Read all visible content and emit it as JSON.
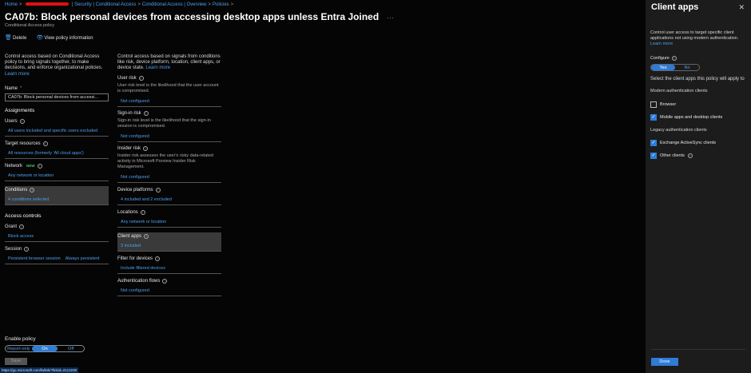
{
  "breadcrumb": {
    "home": "Home",
    "items": [
      "Security | Conditional Access",
      "Conditional Access | Overview",
      "Policies"
    ]
  },
  "page": {
    "title": "CA07b: Block personal devices from accessing desktop apps unless Entra Joined",
    "more": "···",
    "subtitle": "Conditional Access policy"
  },
  "toolbar": {
    "delete_label": "Delete",
    "view_info_label": "View policy information"
  },
  "left": {
    "intro": "Control access based on Conditional Access policy to bring signals together, to make decisions, and enforce organizational policies.",
    "learn_more": "Learn more",
    "name_label": "Name",
    "name_required": "*",
    "name_value": "CA07b: Block personal devices from accessi...",
    "assignments": "Assignments",
    "users_label": "Users",
    "users_value": "All users included and specific users excluded",
    "target_label": "Target resources",
    "target_value": "All resources (formerly 'All cloud apps')",
    "network_label": "Network",
    "network_badge": "NEW",
    "network_value": "Any network or location",
    "conditions_label": "Conditions",
    "conditions_value": "4 conditions selected",
    "access_controls": "Access controls",
    "grant_label": "Grant",
    "grant_value": "Block access",
    "session_label": "Session",
    "session_value1": "Persistent browser session",
    "session_value2": "Always persistent"
  },
  "right": {
    "intro": "Control access based on signals from conditions like risk, device platform, location, client apps, or device state.",
    "learn_more": "Learn more",
    "user_risk_label": "User risk",
    "user_risk_desc": "User risk level is the likelihood that the user account is compromised.",
    "user_risk_value": "Not configured",
    "signin_risk_label": "Sign-in risk",
    "signin_risk_desc": "Sign-in risk level is the likelihood that the sign-in session is compromised.",
    "signin_risk_value": "Not configured",
    "insider_risk_label": "Insider risk",
    "insider_risk_desc": "Insider risk assesses the user's risky data-related activity in Microsoft Purview Insider Risk Management.",
    "insider_risk_value": "Not configured",
    "device_platforms_label": "Device platforms",
    "device_platforms_value": "4 included and 2 excluded",
    "locations_label": "Locations",
    "locations_value": "Any network or location",
    "client_apps_label": "Client apps",
    "client_apps_value": "3 included",
    "filter_label": "Filter for devices",
    "filter_value": "Include filtered devices",
    "auth_flows_label": "Authentication flows",
    "auth_flows_value": "Not configured"
  },
  "enable": {
    "label": "Enable policy",
    "options": [
      "Report-only",
      "On",
      "Off"
    ],
    "selected": "On"
  },
  "save_label": "Save",
  "status_url": "https://go.microsoft.com/fwlink/?linkid=2113230",
  "panel": {
    "title": "Client apps",
    "intro": "Control user access to target specific client applications not using modern authentication.",
    "learn_more": "Learn more",
    "configure_label": "Configure",
    "configure_yes": "Yes",
    "configure_no": "No",
    "select_text": "Select the client apps this policy will apply to",
    "modern_head": "Modern authentication clients",
    "browser": "Browser",
    "mobile": "Mobile apps and desktop clients",
    "legacy_head": "Legacy authentication clients",
    "exchange": "Exchange ActiveSync clients",
    "other": "Other clients",
    "done_label": "Done"
  },
  "colors": {
    "accent": "#2f7bd8",
    "link": "#4aa0f0"
  }
}
